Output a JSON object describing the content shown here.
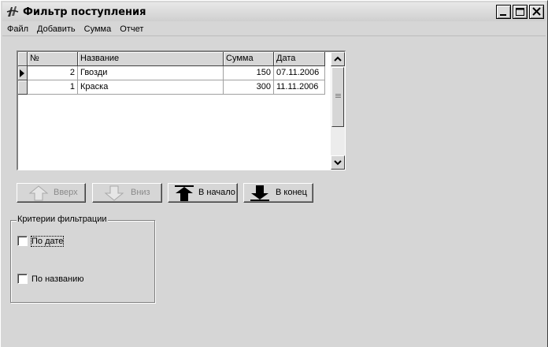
{
  "window": {
    "title": "Фильтр поступления"
  },
  "menu": [
    {
      "label": "Файл"
    },
    {
      "label": "Добавить"
    },
    {
      "label": "Сумма"
    },
    {
      "label": "Отчет"
    }
  ],
  "grid": {
    "columns": [
      "№",
      "Название",
      "Сумма",
      "Дата"
    ],
    "rows": [
      {
        "n": "2",
        "name": "Гвозди",
        "sum": "150",
        "date": "07.11.2006",
        "current": true
      },
      {
        "n": "1",
        "name": "Краска",
        "sum": "300",
        "date": "11.11.2006",
        "current": false
      }
    ]
  },
  "nav_buttons": {
    "up": "Вверх",
    "down": "Вниз",
    "first": "В начало",
    "last": "В конец"
  },
  "filter": {
    "title": "Критерии фильтрации",
    "by_date": {
      "label": "По дате",
      "checked": false
    },
    "by_name": {
      "label": "По названию",
      "checked": false
    }
  }
}
